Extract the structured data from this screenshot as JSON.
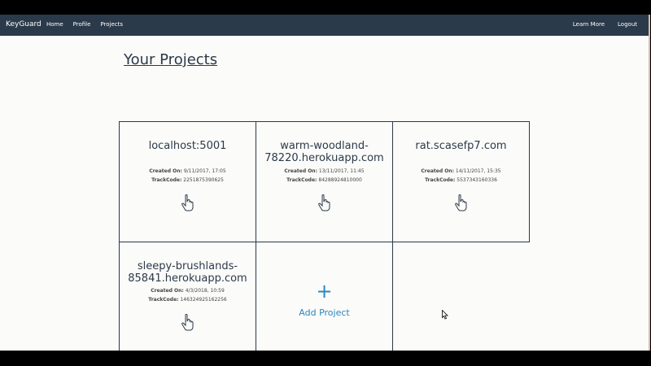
{
  "navbar": {
    "brand": "KeyGuard",
    "links_left": [
      "Home",
      "Profile",
      "Projects"
    ],
    "links_right": [
      "Learn More",
      "Logout"
    ],
    "background": "#2b3a4a"
  },
  "page": {
    "title": "Your Projects"
  },
  "projects": [
    {
      "name": "localhost:5001",
      "created_label": "Created On:",
      "created": "9/11/2017, 17:05",
      "trackcode_label": "TrackCode:",
      "trackcode": "2251875390625",
      "icon": "hand-pointer-icon"
    },
    {
      "name": "warm-woodland-78220.herokuapp.com",
      "created_label": "Created On:",
      "created": "13/11/2017, 11:45",
      "trackcode_label": "TrackCode:",
      "trackcode": "84288924810000",
      "icon": "hand-pointer-icon"
    },
    {
      "name": "rat.scasefp7.com",
      "created_label": "Created On:",
      "created": "14/11/2017, 15:35",
      "trackcode_label": "TrackCode:",
      "trackcode": "5537343160336",
      "icon": "hand-pointer-icon"
    },
    {
      "name": "sleepy-brushlands-85841.herokuapp.com",
      "created_label": "Created On:",
      "created": "4/3/2018, 10:59",
      "trackcode_label": "TrackCode:",
      "trackcode": "146324925162256",
      "icon": "hand-pointer-icon"
    }
  ],
  "add_project": {
    "plus": "+",
    "label": "Add Project",
    "color": "#2a86c2"
  }
}
